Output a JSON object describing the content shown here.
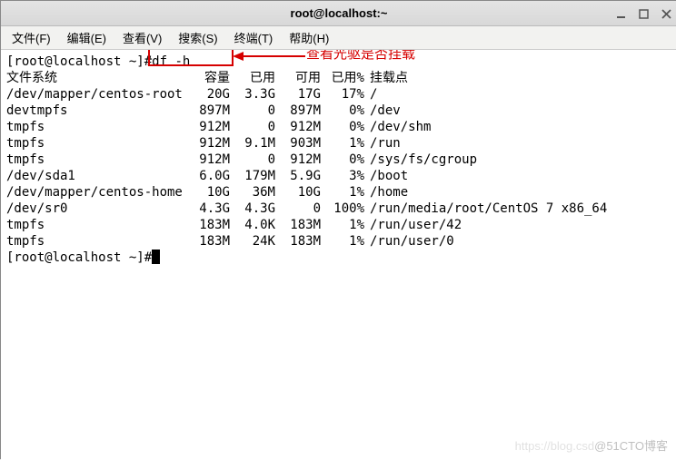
{
  "window": {
    "title": "root@localhost:~"
  },
  "menu": {
    "file": "文件(F)",
    "edit": "编辑(E)",
    "view": "查看(V)",
    "search": "搜索(S)",
    "terminal": "终端(T)",
    "help": "帮助(H)"
  },
  "prompt": {
    "line1_pre": "[root@localhost ~]# ",
    "line1_cmd": "df -h",
    "line2": "[root@localhost ~]# "
  },
  "hdr": {
    "fs": "文件系统",
    "size": "容量",
    "used": "已用",
    "avail": "可用",
    "pct": "已用%",
    "mnt": "挂载点"
  },
  "rows": [
    {
      "fs": "/dev/mapper/centos-root",
      "size": "20G",
      "used": "3.3G",
      "avail": "17G",
      "pct": "17%",
      "mnt": "/"
    },
    {
      "fs": "devtmpfs",
      "size": "897M",
      "used": "0",
      "avail": "897M",
      "pct": "0%",
      "mnt": "/dev"
    },
    {
      "fs": "tmpfs",
      "size": "912M",
      "used": "0",
      "avail": "912M",
      "pct": "0%",
      "mnt": "/dev/shm"
    },
    {
      "fs": "tmpfs",
      "size": "912M",
      "used": "9.1M",
      "avail": "903M",
      "pct": "1%",
      "mnt": "/run"
    },
    {
      "fs": "tmpfs",
      "size": "912M",
      "used": "0",
      "avail": "912M",
      "pct": "0%",
      "mnt": "/sys/fs/cgroup"
    },
    {
      "fs": "/dev/sda1",
      "size": "6.0G",
      "used": "179M",
      "avail": "5.9G",
      "pct": "3%",
      "mnt": "/boot"
    },
    {
      "fs": "/dev/mapper/centos-home",
      "size": "10G",
      "used": "36M",
      "avail": "10G",
      "pct": "1%",
      "mnt": "/home"
    },
    {
      "fs": "/dev/sr0",
      "size": "4.3G",
      "used": "4.3G",
      "avail": "0",
      "pct": "100%",
      "mnt": "/run/media/root/CentOS 7 x86_64"
    },
    {
      "fs": "tmpfs",
      "size": "183M",
      "used": "4.0K",
      "avail": "183M",
      "pct": "1%",
      "mnt": "/run/user/42"
    },
    {
      "fs": "tmpfs",
      "size": "183M",
      "used": "24K",
      "avail": "183M",
      "pct": "1%",
      "mnt": "/run/user/0"
    }
  ],
  "annotation": {
    "text": "查看光驱是否挂载"
  },
  "watermark": {
    "faint": "https://blog.csd",
    "text": "@51CTO博客"
  }
}
